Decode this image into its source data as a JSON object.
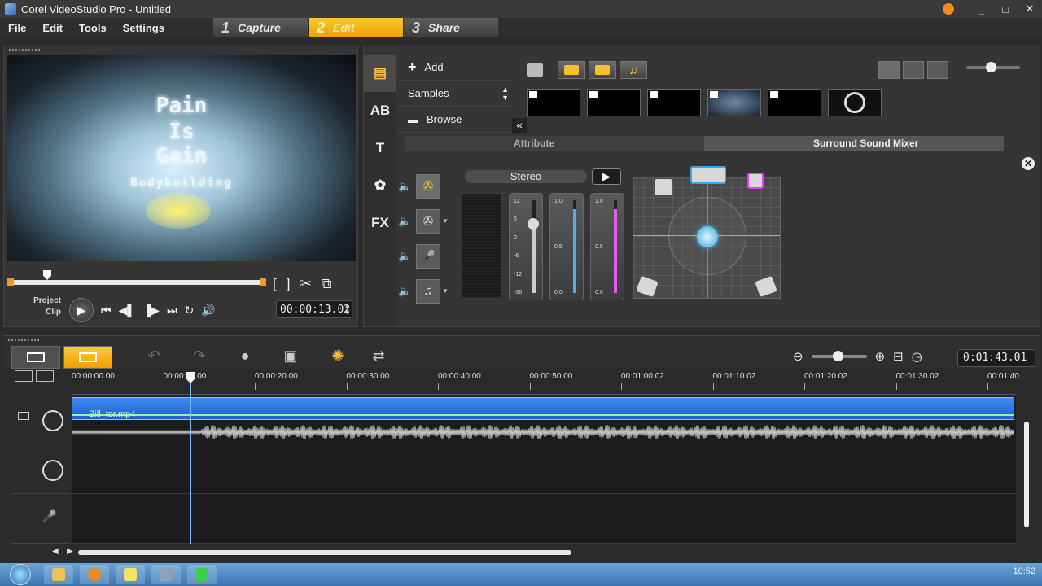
{
  "window": {
    "title": "Corel VideoStudio Pro - Untitled",
    "controls": [
      "_",
      "□",
      "✕"
    ]
  },
  "menu": {
    "items": [
      "File",
      "Edit",
      "Tools",
      "Settings"
    ]
  },
  "steps": [
    {
      "num": "1",
      "label": "Capture"
    },
    {
      "num": "2",
      "label": "Edit"
    },
    {
      "num": "3",
      "label": "Share"
    }
  ],
  "preview": {
    "title_lines": [
      "Pain",
      "Is",
      "Gain"
    ],
    "subtitle": "Bodybuilding",
    "mode_project": "Project",
    "mode_clip": "Clip",
    "trim_in": "[",
    "trim_out": "]",
    "timecode": "00:00:13.02"
  },
  "library": {
    "side_icons": [
      "media-icon",
      "AB",
      "T",
      "filter-icon",
      "FX"
    ],
    "nav": {
      "add": "Add",
      "samples": "Samples",
      "browse": "Browse"
    },
    "tabs": {
      "attribute": "Attribute",
      "surround": "Surround Sound Mixer"
    },
    "stereo": "Stereo"
  },
  "mixer": {
    "faders": [
      {
        "ticks": [
          "12",
          "6",
          "0",
          "-6",
          "-12",
          "-36"
        ],
        "level": 0.75,
        "color": "#cccccc"
      },
      {
        "ticks": [
          "1.0",
          "0.5",
          "0.0"
        ],
        "level": 0.9,
        "color": "#5aa8f0"
      },
      {
        "ticks": [
          "1.0",
          "0.5",
          "0.0"
        ],
        "level": 0.9,
        "color": "#e060e8"
      }
    ]
  },
  "timeline": {
    "project_time": "0:01:43.01",
    "ruler": [
      "00:00:00.00",
      "00:00:10.00",
      "00:00:20.00",
      "00:00:30.00",
      "00:00:40.00",
      "00:00:50.00",
      "00:01:00.02",
      "00:01:10.02",
      "00:01:20.02",
      "00:01:30.02",
      "00:01:40"
    ],
    "clip_name": "Bill_tor.mp4"
  },
  "taskbar": {
    "clock": "10:52"
  },
  "colors": {
    "accent": "#f0a000",
    "clip": "#2f76e0",
    "playhead": "#7ab8ff"
  }
}
